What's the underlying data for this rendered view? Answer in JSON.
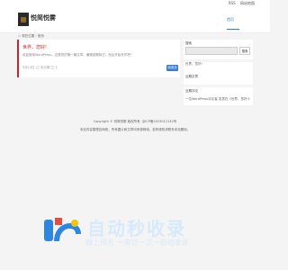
{
  "topbar": {
    "links": [
      "RSS",
      "网站地图"
    ]
  },
  "header": {
    "site_title": "悦简悦雾",
    "nav_home": "首页"
  },
  "breadcrumb": "☖ 现在位置 › 首页",
  "post": {
    "title": "世界，您好!",
    "excerpt": "欢迎使用WordPress。这是您的第一篇文章。编辑或删除它，然后开始写作吧！",
    "meta": "3月13日 ◯ 未分类 ◯ 1",
    "read_more": "阅读全文"
  },
  "sidebar": {
    "search_title": "搜索",
    "search_button": "搜索",
    "recent_posts_title": "近期文章",
    "recent_posts": [
      "世界，您好!"
    ],
    "recent_comments_title": "近期评论",
    "recent_comments": [
      "一位WordPress评论者 发表在《世界，您好!》"
    ]
  },
  "footer": {
    "line1": "Copyright © 悦简悦雾  版权所有. 京ICP备2023012142号",
    "line2": "本站内容整理自网络，所有图片和文章均来源网络。若有侵权请联系本站删除。"
  },
  "watermark": {
    "big": "自动秒收录",
    "small": "做上排名 一来访一次一自动收录"
  },
  "colors": {
    "accent": "#c62828",
    "link": "#2a80b9",
    "button": "#3a7bd5"
  }
}
